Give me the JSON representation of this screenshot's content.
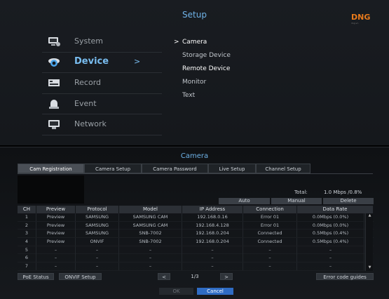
{
  "setup": {
    "title": "Setup",
    "logo": {
      "text": "DNG",
      "sub": "dng.vn"
    },
    "menu": [
      {
        "label": "System",
        "icon": "system-icon"
      },
      {
        "label": "Device",
        "icon": "device-icon",
        "active": true,
        "arrow": ">"
      },
      {
        "label": "Record",
        "icon": "record-icon"
      },
      {
        "label": "Event",
        "icon": "event-icon"
      },
      {
        "label": "Network",
        "icon": "network-icon"
      }
    ],
    "submenu": [
      {
        "label": "Camera",
        "selected": true,
        "chevron": ">"
      },
      {
        "label": "Storage Device"
      },
      {
        "label": "Remote Device"
      },
      {
        "label": "Monitor"
      },
      {
        "label": "Text"
      }
    ]
  },
  "camera": {
    "title": "Camera",
    "tabs": [
      {
        "label": "Cam Registration",
        "active": true
      },
      {
        "label": "Camera Setup"
      },
      {
        "label": "Camera Password"
      },
      {
        "label": "Live Setup"
      },
      {
        "label": "Channel Setup"
      }
    ],
    "total_label": "Total:",
    "total_value": "1.0  Mbps /0.8%",
    "buttons": {
      "auto": "Auto",
      "manual": "Manual",
      "delete": "Delete"
    },
    "columns": [
      "CH",
      "Preview",
      "Protocol",
      "Model",
      "IP Address",
      "Connection",
      "Data Rate"
    ],
    "rows": [
      [
        "1",
        "Preview",
        "SAMSUNG",
        "SAMSUNG CAM",
        "192.168.0.16",
        "Error 01",
        "0.0Mbps (0.0%)"
      ],
      [
        "2",
        "Preview",
        "SAMSUNG",
        "SAMSUNG CAM",
        "192.168.4.128",
        "Error 01",
        "0.0Mbps (0.0%)"
      ],
      [
        "3",
        "Preview",
        "SAMSUNG",
        "SNB-7002",
        "192.168.0.204",
        "Connected",
        "0.5Mbps (0.4%)"
      ],
      [
        "4",
        "Preview",
        "ONVIF",
        "SNB-7002",
        "192.168.0.204",
        "Connected",
        "0.5Mbps (0.4%)"
      ],
      [
        "5",
        "–",
        "–",
        "–",
        "–",
        "–",
        "–"
      ],
      [
        "6",
        "–",
        "–",
        "–",
        "–",
        "–",
        "–"
      ],
      [
        "7",
        "–",
        "–",
        "–",
        "–",
        "–",
        "–"
      ]
    ],
    "footer": {
      "poe_status": "PoE Status",
      "onvif_setup": "ONVIF Setup",
      "prev": "<",
      "page": "1/3",
      "next": ">",
      "error_guides": "Error code guides",
      "ok": "OK",
      "cancel": "Cancel"
    }
  }
}
